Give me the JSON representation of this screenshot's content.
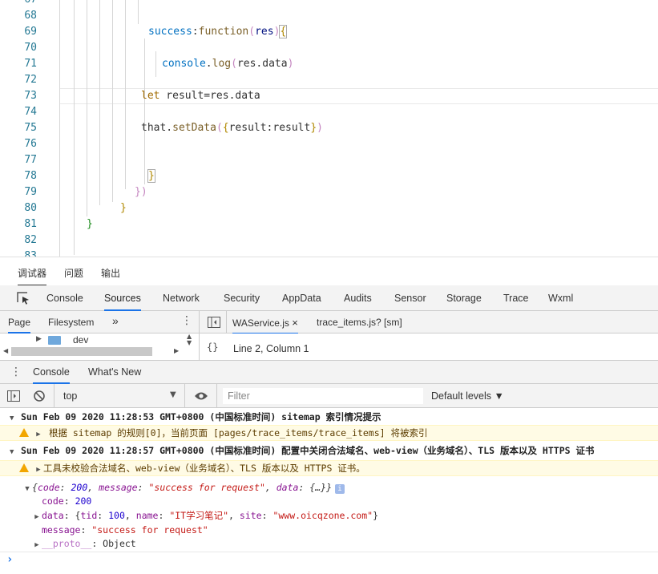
{
  "editor": {
    "lines": [
      {
        "num": "67"
      },
      {
        "num": "68"
      },
      {
        "num": "69"
      },
      {
        "num": "70"
      },
      {
        "num": "71"
      },
      {
        "num": "72"
      },
      {
        "num": "73"
      },
      {
        "num": "74"
      },
      {
        "num": "75"
      },
      {
        "num": "76"
      },
      {
        "num": "77"
      },
      {
        "num": "78"
      },
      {
        "num": "79"
      },
      {
        "num": "80"
      },
      {
        "num": "81"
      },
      {
        "num": "82"
      },
      {
        "num": "83"
      }
    ],
    "code": {
      "l69_prop": "success",
      "l69_colon": ":",
      "l69_kw": "function",
      "l69_open": "(",
      "l69_arg": "res",
      "l69_close": ")",
      "l69_brace": "{",
      "l71_obj": "console",
      "l71_dot": ".",
      "l71_fn": "log",
      "l71_open": "(",
      "l71_arg": "res.data",
      "l71_close": ")",
      "l73_let": "let",
      "l73_rest": " result=res.data",
      "l75_that": "that.",
      "l75_fn": "setData",
      "l75_open": "(",
      "l75_brace_open": "{",
      "l75_body": "result:result",
      "l75_brace_close": "}",
      "l75_close": ")",
      "l78_brace": "}",
      "l79_close": "})",
      "l80_brace": "}",
      "l81_brace": "}"
    }
  },
  "top_tabs": [
    "调试器",
    "问题",
    "输出"
  ],
  "dev_tabs": [
    "Console",
    "Sources",
    "Network",
    "Security",
    "AppData",
    "Audits",
    "Sensor",
    "Storage",
    "Trace",
    "Wxml"
  ],
  "sources": {
    "nav_tabs": [
      "Page",
      "Filesystem"
    ],
    "more": "»",
    "files": [
      {
        "name": "WAService.js",
        "close": "×"
      },
      {
        "name": "trace_items.js? [sm]"
      }
    ],
    "tree_item": "dev",
    "pretty_print": "{}",
    "position": "Line 2, Column 1"
  },
  "console_tabs": [
    "Console",
    "What's New"
  ],
  "console_toolbar": {
    "context": "top",
    "filter_placeholder": "Filter",
    "levels": "Default levels ▼"
  },
  "console": {
    "group1": "Sun Feb 09 2020 11:28:53 GMT+0800 (中国标准时间) sitemap 索引情况提示",
    "warn1": "根据 sitemap 的规则[0]，当前页面 [pages/trace_items/trace_items] 将被索引",
    "group2": "Sun Feb 09 2020 11:28:57 GMT+0800 (中国标准时间) 配置中关闭合法域名、web-view（业务域名）、TLS 版本以及 HTTPS 证书",
    "warn2": "工具未校验合法域名、web-view（业务域名）、TLS 版本以及 HTTPS 证书。",
    "obj": {
      "open": "{",
      "k1": "code",
      "v1": "200",
      "k2": "message",
      "v2": "\"success for request\"",
      "k3": "data",
      "v3": "{…}",
      "close": "}",
      "info": "i"
    },
    "code_key": "code",
    "code_val": "200",
    "data_key": "data",
    "data_tid_key": "tid",
    "data_tid_val": "100",
    "data_name_key": "name",
    "data_name_val": "\"IT学习笔记\"",
    "data_site_key": "site",
    "data_site_val": "\"www.oicqzone.com\"",
    "msg_key": "message",
    "msg_val": "\"success for request\"",
    "proto_key": "__proto__",
    "proto_val": "Object",
    "prompt": "›"
  },
  "colors": {
    "accent": "#1a73e8",
    "warning_bg": "#fffbe5",
    "line_number": "#237893"
  }
}
